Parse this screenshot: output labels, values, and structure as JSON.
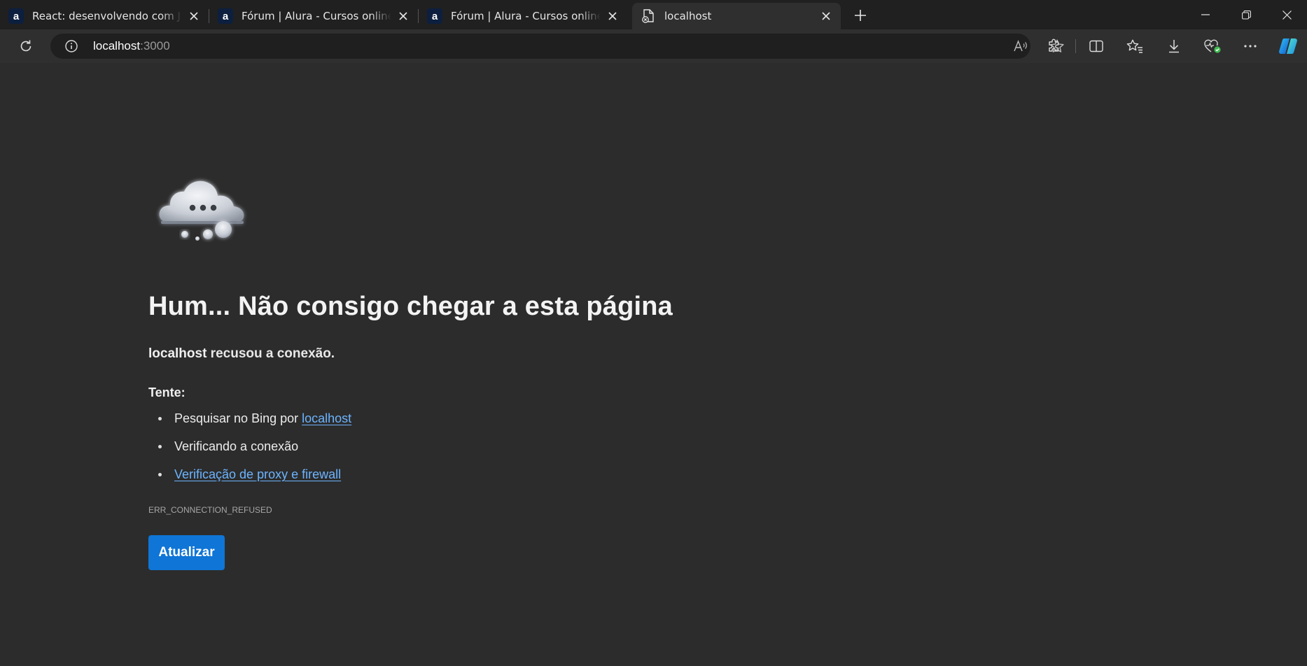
{
  "tabs": [
    {
      "title": "React: desenvolvendo com JavaScript",
      "favicon": "alura-icon"
    },
    {
      "title": "Fórum | Alura - Cursos online de tecnologia",
      "favicon": "alura-icon"
    },
    {
      "title": "Fórum | Alura - Cursos online de tecnologia",
      "favicon": "alura-icon"
    },
    {
      "title": "localhost",
      "favicon": "error-page-icon",
      "active": true
    }
  ],
  "omnibox": {
    "host": "localhost",
    "port": ":3000"
  },
  "error": {
    "heading": "Hum... Não consigo chegar a esta página",
    "host": "localhost",
    "message": " recusou a conexão.",
    "try_label": "Tente:",
    "suggestion_1_prefix": "Pesquisar no Bing por ",
    "suggestion_1_link": "localhost",
    "suggestion_2": "Verificando a conexão",
    "suggestion_3_link": "Verificação de proxy e firewall",
    "code": "ERR_CONNECTION_REFUSED",
    "refresh_label": "Atualizar"
  },
  "colors": {
    "accent": "#0f75d6",
    "link": "#6cb4ff",
    "background": "#2c2c2c"
  }
}
